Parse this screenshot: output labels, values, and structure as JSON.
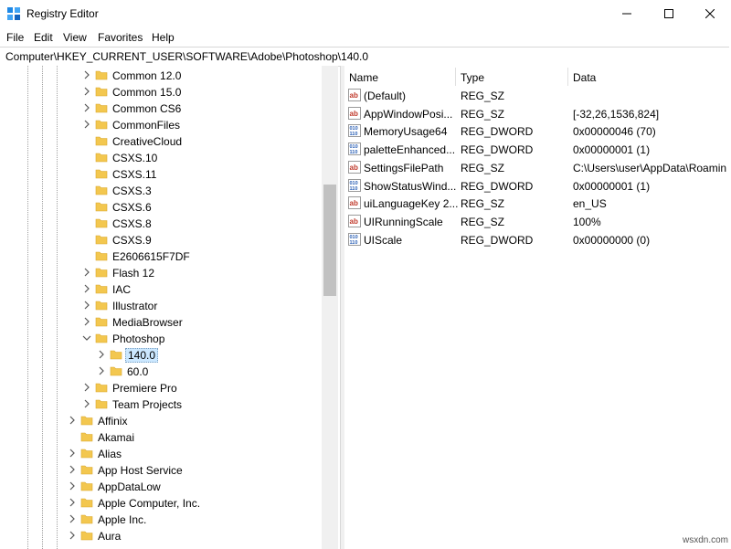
{
  "window": {
    "title": "Registry Editor",
    "controls": {
      "minimize": "minimize-icon",
      "maximize": "maximize-icon",
      "close": "close-icon"
    }
  },
  "menu": [
    "File",
    "Edit",
    "View",
    "Favorites",
    "Help"
  ],
  "address": "Computer\\HKEY_CURRENT_USER\\SOFTWARE\\Adobe\\Photoshop\\140.0",
  "tree": [
    {
      "label": "Common 12.0",
      "state": "collapsed"
    },
    {
      "label": "Common 15.0",
      "state": "collapsed"
    },
    {
      "label": "Common CS6",
      "state": "collapsed"
    },
    {
      "label": "CommonFiles",
      "state": "collapsed"
    },
    {
      "label": "CreativeCloud",
      "state": "leaf"
    },
    {
      "label": "CSXS.10",
      "state": "leaf"
    },
    {
      "label": "CSXS.11",
      "state": "leaf"
    },
    {
      "label": "CSXS.3",
      "state": "leaf"
    },
    {
      "label": "CSXS.6",
      "state": "leaf"
    },
    {
      "label": "CSXS.8",
      "state": "leaf"
    },
    {
      "label": "CSXS.9",
      "state": "leaf"
    },
    {
      "label": "E2606615F7DF",
      "state": "leaf"
    },
    {
      "label": "Flash 12",
      "state": "collapsed"
    },
    {
      "label": "IAC",
      "state": "collapsed"
    },
    {
      "label": "Illustrator",
      "state": "collapsed"
    },
    {
      "label": "MediaBrowser",
      "state": "collapsed"
    },
    {
      "label": "Photoshop",
      "state": "expanded"
    },
    {
      "label": "140.0",
      "state": "collapsed",
      "selected": true
    },
    {
      "label": "60.0",
      "state": "collapsed"
    },
    {
      "label": "Premiere Pro",
      "state": "collapsed"
    },
    {
      "label": "Team Projects",
      "state": "collapsed"
    },
    {
      "label": "Affinix",
      "state": "collapsed"
    },
    {
      "label": "Akamai",
      "state": "leaf"
    },
    {
      "label": "Alias",
      "state": "collapsed"
    },
    {
      "label": "App Host Service",
      "state": "collapsed"
    },
    {
      "label": "AppDataLow",
      "state": "collapsed"
    },
    {
      "label": "Apple Computer, Inc.",
      "state": "collapsed"
    },
    {
      "label": "Apple Inc.",
      "state": "collapsed"
    },
    {
      "label": "Aura",
      "state": "collapsed"
    }
  ],
  "list": {
    "columns": [
      "Name",
      "Type",
      "Data"
    ],
    "rows": [
      {
        "name": "(Default)",
        "type": "REG_SZ",
        "data": "",
        "icon": "string-value-icon"
      },
      {
        "name": "AppWindowPosi...",
        "type": "REG_SZ",
        "data": "[-32,26,1536,824]",
        "icon": "string-value-icon"
      },
      {
        "name": "MemoryUsage64",
        "type": "REG_DWORD",
        "data": "0x00000046 (70)",
        "icon": "binary-value-icon"
      },
      {
        "name": "paletteEnhanced...",
        "type": "REG_DWORD",
        "data": "0x00000001 (1)",
        "icon": "binary-value-icon"
      },
      {
        "name": "SettingsFilePath",
        "type": "REG_SZ",
        "data": "C:\\Users\\user\\AppData\\Roamin",
        "icon": "string-value-icon"
      },
      {
        "name": "ShowStatusWind...",
        "type": "REG_DWORD",
        "data": "0x00000001 (1)",
        "icon": "binary-value-icon"
      },
      {
        "name": "uiLanguageKey 2...",
        "type": "REG_SZ",
        "data": "en_US",
        "icon": "string-value-icon"
      },
      {
        "name": "UIRunningScale",
        "type": "REG_SZ",
        "data": "100%",
        "icon": "string-value-icon"
      },
      {
        "name": "UIScale",
        "type": "REG_DWORD",
        "data": "0x00000000 (0)",
        "icon": "binary-value-icon"
      }
    ]
  },
  "watermark": "wsxdn.com",
  "colors": {
    "folder": "#f3c74f",
    "selection": "#cce8ff",
    "binary_icon": "#2a5fb5",
    "string_icon": "#c0392b"
  }
}
